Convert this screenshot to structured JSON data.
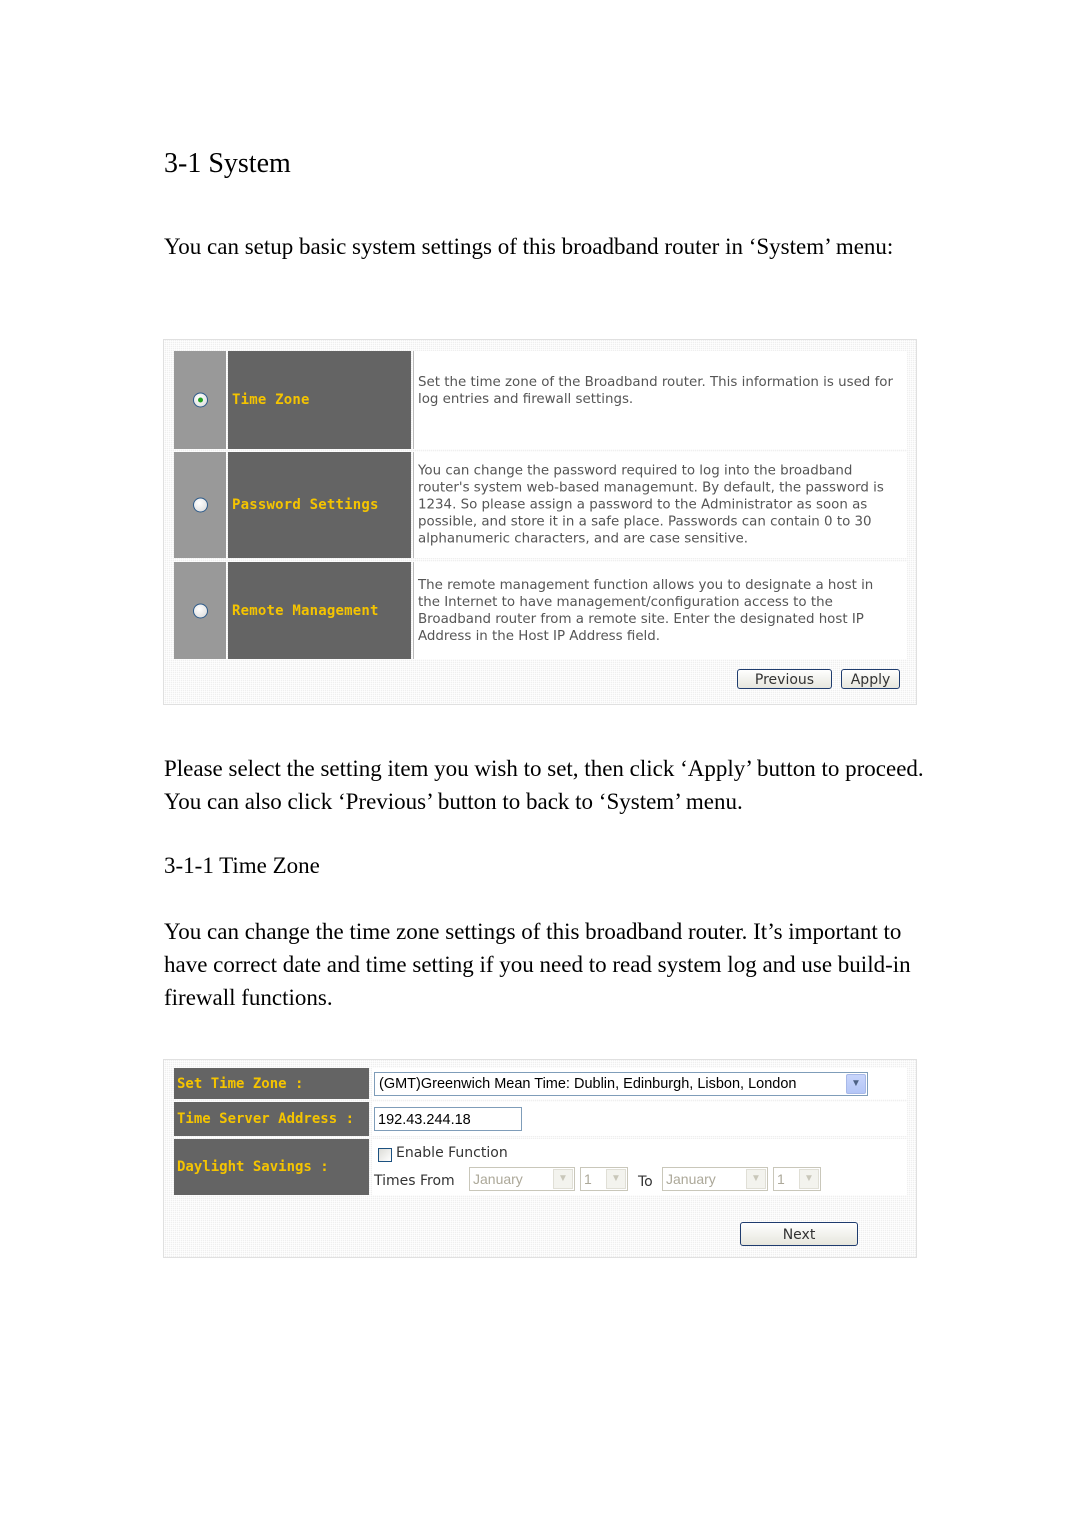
{
  "document": {
    "heading": "3-1 System",
    "intro": "You can setup basic system settings of this broadband router in ‘System’ menu:",
    "instructions": "Please select the setting item you wish to set, then click ‘Apply’ button to proceed. You can also click ‘Previous’ button to back to ‘System’ menu.",
    "subheading": "3-1-1 Time Zone",
    "timezone_intro": "You can change the time zone settings of this broadband router. It’s important to have correct date and time setting if you need to read system log and use build-in firewall functions."
  },
  "system_menu": {
    "items": [
      {
        "label": "Time Zone",
        "selected": true,
        "description": "Set the time zone of the Broadband router. This information is used for log entries and firewall settings."
      },
      {
        "label": "Password Settings",
        "selected": false,
        "description": "You can change the password required to log into the broadband router's system web-based managemunt. By default, the password is 1234. So please assign a password to the Administrator as soon as possible, and store it in a safe place. Passwords can contain 0 to 30 alphanumeric characters, and are case sensitive."
      },
      {
        "label": "Remote Management",
        "selected": false,
        "description": "The remote management function allows you to designate a host in the Internet to have management/configuration access to the Broadband router from a remote site. Enter the designated host IP Address in the Host IP Address field."
      }
    ],
    "previous_label": "Previous",
    "apply_label": "Apply"
  },
  "time_zone_form": {
    "set_time_zone_label": "Set Time Zone :",
    "set_time_zone_value": "(GMT)Greenwich Mean Time: Dublin, Edinburgh, Lisbon, London",
    "time_server_label": "Time Server Address :",
    "time_server_value": "192.43.244.18",
    "daylight_label": "Daylight Savings :",
    "enable_function_label": "Enable Function",
    "enable_function_checked": false,
    "times_from_label": "Times From",
    "to_label": "To",
    "from_month": "January",
    "from_day": "1",
    "to_month": "January",
    "to_day": "1",
    "next_label": "Next"
  },
  "colors": {
    "label_bg": "#646464",
    "label_text": "#f5c400",
    "radio_cell_bg": "#999999"
  }
}
